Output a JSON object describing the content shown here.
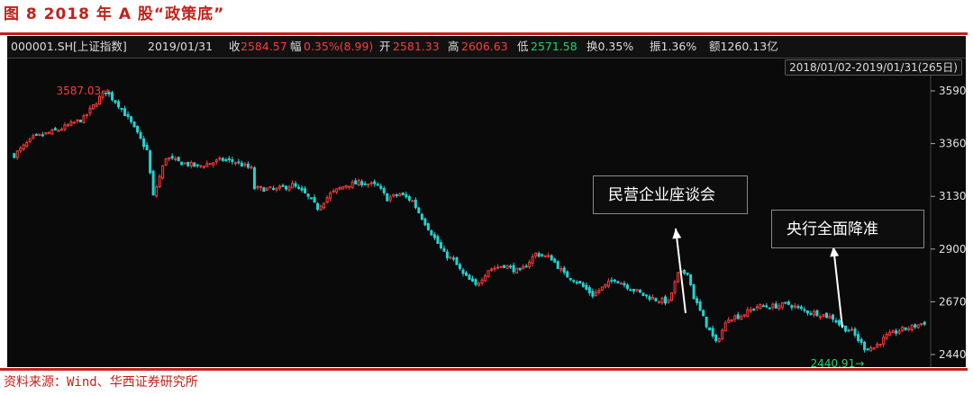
{
  "figure": {
    "title": "图 8 2018 年 A 股“政策底”",
    "source": "资料来源：Wind、华西证券研究所"
  },
  "info_bar": {
    "code": "000001.SH[上证指数]",
    "date": "2019/01/31",
    "close_label": "收",
    "close_value": "2584.57",
    "change_label": "幅",
    "change_value": "0.35%(8.99)",
    "open_label": "开",
    "open_value": "2581.33",
    "high_label": "高",
    "high_value": "2606.63",
    "low_label": "低",
    "low_value": "2571.58",
    "turnover": "换0.35%",
    "amplitude": "振1.36%",
    "amount": "额1260.13亿"
  },
  "range_label": "2018/01/02-2019/01/31(265日)",
  "colors": {
    "up": "#ff3b3b",
    "down": "#22d3d3",
    "panel_bg": "#0a0a0a",
    "accent": "#c0221b",
    "max_label": "#ff3b3b",
    "min_label": "#22d36a"
  },
  "chart_data": {
    "type": "candlestick",
    "title": "",
    "xlabel": "",
    "ylabel": "",
    "x_range": [
      "2018/01/02",
      "2019/01/31"
    ],
    "ylim": [
      2420,
      3620
    ],
    "y_ticks": [
      3590,
      3360,
      3130,
      2900,
      2670,
      2440
    ],
    "grid": false,
    "max_label": "3587.03",
    "min_label": "2440.91",
    "anchors": [
      [
        0,
        3310
      ],
      [
        6,
        3385
      ],
      [
        14,
        3420
      ],
      [
        22,
        3470
      ],
      [
        27,
        3560
      ],
      [
        29,
        3587
      ],
      [
        33,
        3530
      ],
      [
        37,
        3450
      ],
      [
        42,
        3330
      ],
      [
        44,
        3130
      ],
      [
        48,
        3300
      ],
      [
        52,
        3280
      ],
      [
        58,
        3260
      ],
      [
        66,
        3290
      ],
      [
        70,
        3280
      ],
      [
        75,
        3250
      ],
      [
        76,
        3165
      ],
      [
        83,
        3160
      ],
      [
        88,
        3180
      ],
      [
        92,
        3140
      ],
      [
        96,
        3080
      ],
      [
        100,
        3140
      ],
      [
        105,
        3180
      ],
      [
        110,
        3190
      ],
      [
        115,
        3175
      ],
      [
        118,
        3120
      ],
      [
        122,
        3140
      ],
      [
        126,
        3110
      ],
      [
        128,
        3060
      ],
      [
        132,
        2970
      ],
      [
        136,
        2880
      ],
      [
        139,
        2850
      ],
      [
        142,
        2790
      ],
      [
        146,
        2740
      ],
      [
        150,
        2810
      ],
      [
        155,
        2830
      ],
      [
        160,
        2800
      ],
      [
        165,
        2880
      ],
      [
        170,
        2860
      ],
      [
        174,
        2790
      ],
      [
        178,
        2760
      ],
      [
        183,
        2700
      ],
      [
        186,
        2730
      ],
      [
        190,
        2770
      ],
      [
        195,
        2730
      ],
      [
        199,
        2700
      ],
      [
        203,
        2680
      ],
      [
        207,
        2670
      ],
      [
        210,
        2790
      ],
      [
        213,
        2800
      ],
      [
        215,
        2690
      ],
      [
        219,
        2570
      ],
      [
        222,
        2490
      ],
      [
        226,
        2600
      ],
      [
        230,
        2610
      ],
      [
        235,
        2650
      ],
      [
        240,
        2650
      ],
      [
        245,
        2660
      ],
      [
        250,
        2630
      ],
      [
        254,
        2620
      ],
      [
        259,
        2600
      ],
      [
        262,
        2560
      ],
      [
        265,
        2540
      ],
      [
        269,
        2470
      ],
      [
        272,
        2470
      ],
      [
        276,
        2520
      ],
      [
        280,
        2545
      ],
      [
        284,
        2560
      ],
      [
        288,
        2580
      ]
    ],
    "annotations": [
      {
        "text": "民营企业座谈会"
      },
      {
        "text": "央行全面降准"
      }
    ]
  }
}
